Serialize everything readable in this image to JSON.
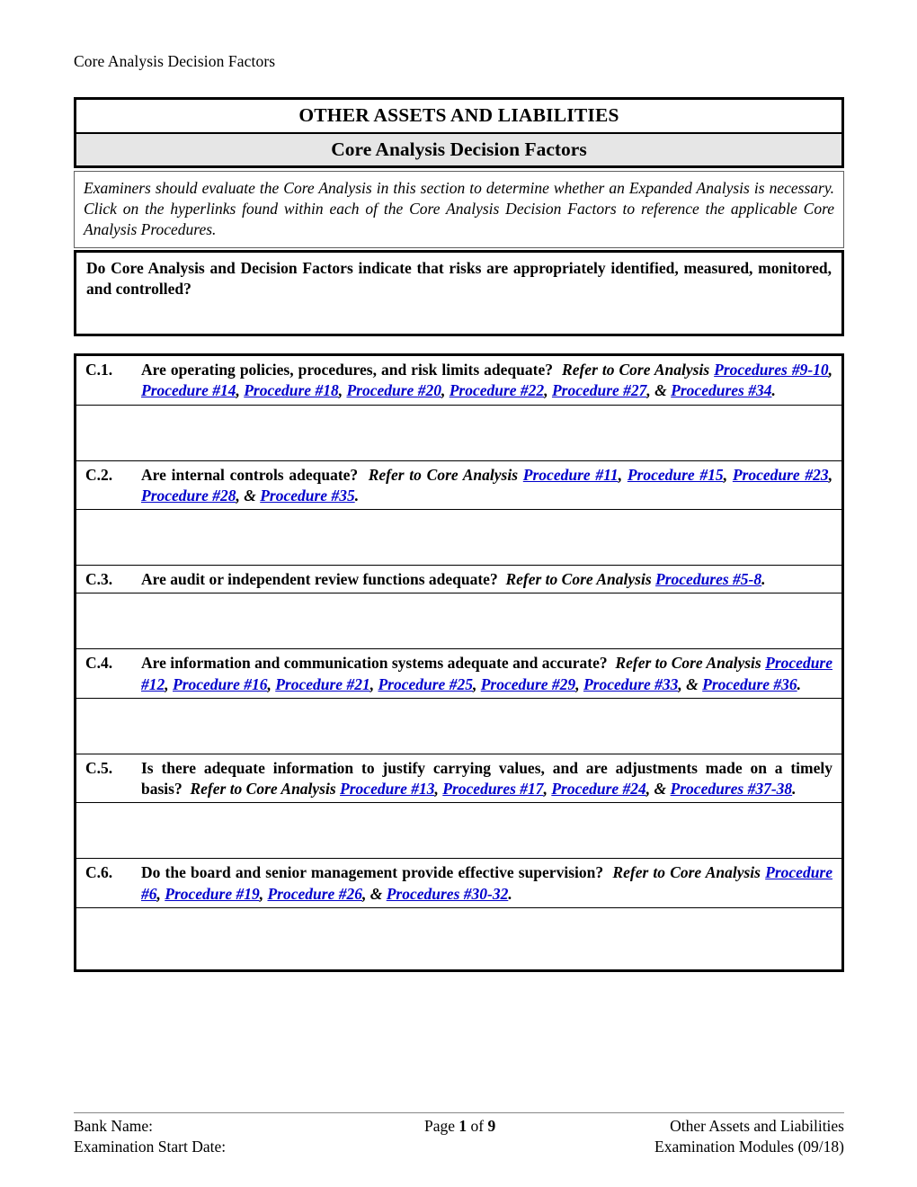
{
  "running_header": "Core Analysis Decision Factors",
  "title_block": {
    "main_title": "OTHER ASSETS AND LIABILITIES",
    "sub_title": "Core Analysis Decision Factors",
    "sub_background": "#e6e6e6"
  },
  "intro": {
    "text": "Examiners should evaluate the Core Analysis in this section to determine whether an Expanded Analysis is necessary.  Click on the hyperlinks found within each of the Core Analysis Decision Factors to reference the applicable Core Analysis Procedures."
  },
  "main_question": {
    "text": "Do Core Analysis and Decision Factors indicate that risks are appropriately identified, measured, monitored, and controlled?"
  },
  "link_color": "#0000cc",
  "factors": [
    {
      "number": "C.1.",
      "question": "Are operating policies, procedures, and risk limits adequate?",
      "refer": "Refer to Core Analysis",
      "links": [
        "Procedures #9-10",
        "Procedure #14",
        "Procedure #18",
        "Procedure #20",
        "Procedure #22",
        "Procedure #27",
        "Procedures #34"
      ],
      "answer_height": 62
    },
    {
      "number": "C.2.",
      "question": "Are internal controls adequate?",
      "refer": "Refer to Core Analysis",
      "links": [
        "Procedure #11",
        "Procedure #15",
        "Procedure #23",
        "Procedure #28",
        "Procedure #35"
      ],
      "answer_height": 62
    },
    {
      "number": "C.3.",
      "question": "Are audit or independent review functions adequate?",
      "refer": "Refer to Core Analysis",
      "links": [
        "Procedures #5-8"
      ],
      "answer_height": 62
    },
    {
      "number": "C.4.",
      "question": "Are information and communication systems adequate and accurate?",
      "refer": "Refer to Core Analysis",
      "links": [
        "Procedure #12",
        "Procedure #16",
        "Procedure #21",
        "Procedure #25",
        "Procedure #29",
        "Procedure #33",
        "Procedure #36"
      ],
      "answer_height": 62
    },
    {
      "number": "C.5.",
      "question": "Is there adequate information to justify carrying values, and are adjustments made on a timely basis?",
      "refer": "Refer to Core Analysis",
      "links": [
        "Procedure #13",
        "Procedures #17",
        "Procedure #24",
        "Procedures #37-38"
      ],
      "answer_height": 62
    },
    {
      "number": "C.6.",
      "question": "Do the board and senior management provide effective supervision?",
      "refer": "Refer to Core Analysis",
      "links": [
        "Procedure #6",
        "Procedure #19",
        "Procedure #26",
        "Procedures #30-32"
      ],
      "answer_height": 68
    }
  ],
  "footer": {
    "bank_name_label": "Bank Name:",
    "exam_start_label": "Examination Start Date:",
    "page_prefix": "Page",
    "page_number": "1",
    "page_of": "of",
    "page_total": "9",
    "right_line1": "Other Assets and Liabilities",
    "right_line2": "Examination Modules (09/18)"
  }
}
